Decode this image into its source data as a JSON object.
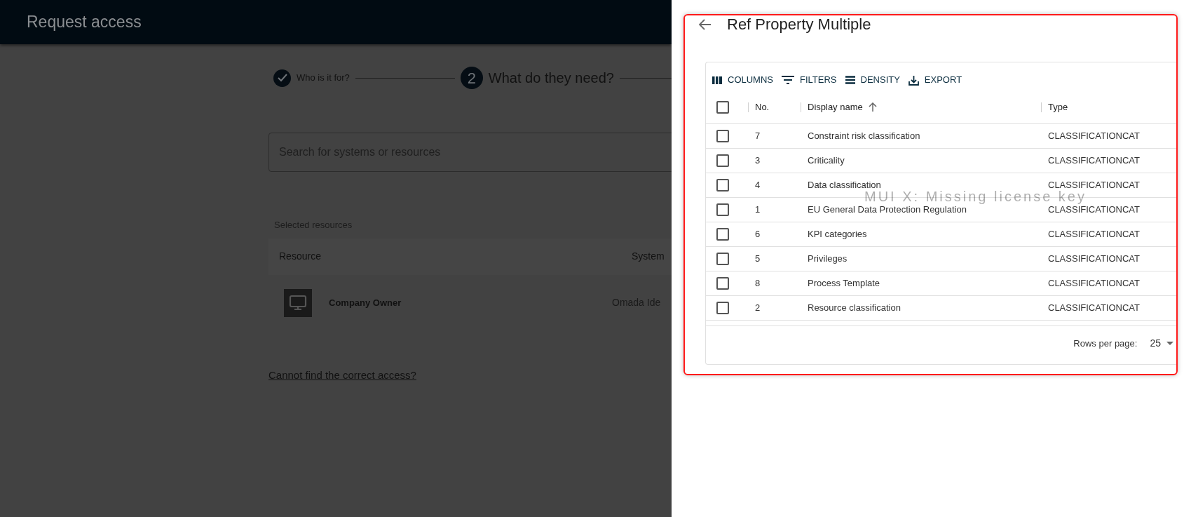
{
  "app": {
    "title": "Request access"
  },
  "stepper": [
    {
      "label": "Who is it for?",
      "completed": true,
      "current": false
    },
    {
      "number": "2",
      "label": "What do they need?",
      "completed": false,
      "current": true
    }
  ],
  "search": {
    "placeholder": "Search for systems or resources"
  },
  "selected_resources": {
    "heading": "Selected resources",
    "columns": [
      "Resource",
      "System"
    ],
    "rows": [
      {
        "resource": "Company Owner",
        "system": "Omada Ide"
      }
    ]
  },
  "help_link": "Cannot find the correct access?",
  "drawer": {
    "title": "Ref Property Multiple",
    "toolbar": [
      {
        "kind": "columns",
        "label": "COLUMNS"
      },
      {
        "kind": "filters",
        "label": "FILTERS"
      },
      {
        "kind": "density",
        "label": "DENSITY"
      },
      {
        "kind": "export",
        "label": "EXPORT"
      }
    ],
    "select_all_checked": false,
    "columns": [
      {
        "label": "No."
      },
      {
        "label": "Display name",
        "sort_ascending": true
      },
      {
        "label": "Type"
      }
    ],
    "rows": [
      {
        "no": "7",
        "name": "Constraint risk classification",
        "type": "CLASSIFICATIONCAT",
        "checked": false
      },
      {
        "no": "3",
        "name": "Criticality",
        "type": "CLASSIFICATIONCAT",
        "checked": false
      },
      {
        "no": "4",
        "name": "Data classification",
        "type": "CLASSIFICATIONCAT",
        "checked": false
      },
      {
        "no": "1",
        "name": "EU General Data Protection Regulation",
        "type": "CLASSIFICATIONCAT",
        "checked": false
      },
      {
        "no": "6",
        "name": "KPI categories",
        "type": "CLASSIFICATIONCAT",
        "checked": false
      },
      {
        "no": "5",
        "name": "Privileges",
        "type": "CLASSIFICATIONCAT",
        "checked": false
      },
      {
        "no": "8",
        "name": "Process Template",
        "type": "CLASSIFICATIONCAT",
        "checked": false
      },
      {
        "no": "2",
        "name": "Resource classification",
        "type": "CLASSIFICATIONCAT",
        "checked": false
      }
    ],
    "rows_per_page_label": "Rows per page:",
    "rows_per_page": "25",
    "watermark": "MUI X: Missing license key"
  }
}
